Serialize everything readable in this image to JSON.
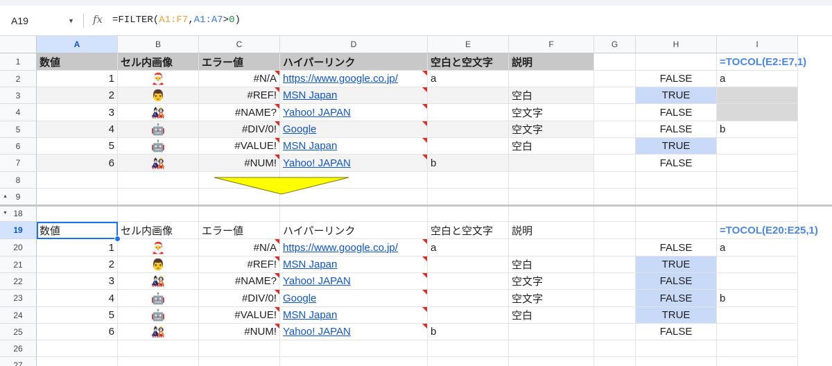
{
  "formula_bar": {
    "cell_ref": "A19",
    "fx": "fx",
    "formula_parts": [
      "=FILTER(",
      "A1:F7",
      ",",
      "A1:A7",
      ">",
      "0",
      ")"
    ]
  },
  "columns": [
    "A",
    "B",
    "C",
    "D",
    "E",
    "F",
    "G",
    "H",
    "I"
  ],
  "rows": [
    "1",
    "2",
    "3",
    "4",
    "5",
    "6",
    "7",
    "8",
    "9",
    "18",
    "19",
    "20",
    "21",
    "22",
    "23",
    "24",
    "25",
    "26",
    "27"
  ],
  "top_table": {
    "headers": [
      "数値",
      "セル内画像",
      "エラー値",
      "ハイパーリンク",
      "空白と空文字",
      "説明"
    ],
    "rows": [
      {
        "num": "1",
        "img": "🎅",
        "err": "#N/A",
        "link": "https://www.google.co.jp/",
        "blank": "a",
        "desc": "",
        "h": "FALSE",
        "i": "a"
      },
      {
        "num": "2",
        "img": "👨",
        "err": "#REF!",
        "link": "MSN Japan",
        "blank": "",
        "desc": "空白",
        "h": "TRUE",
        "i": ""
      },
      {
        "num": "3",
        "img": "🎎",
        "err": "#NAME?",
        "link": "Yahoo! JAPAN",
        "blank": "",
        "desc": "空文字",
        "h": "FALSE",
        "i": ""
      },
      {
        "num": "4",
        "img": "🤖",
        "err": "#DIV/0!",
        "link": "Google",
        "blank": "",
        "desc": "空文字",
        "h": "FALSE",
        "i": "b"
      },
      {
        "num": "5",
        "img": "🤖",
        "err": "#VALUE!",
        "link": "MSN Japan",
        "blank": "",
        "desc": "空白",
        "h": "TRUE",
        "i": ""
      },
      {
        "num": "6",
        "img": "🎎",
        "err": "#NUM!",
        "link": "Yahoo! JAPAN",
        "blank": "b",
        "desc": "",
        "h": "FALSE",
        "i": ""
      }
    ],
    "tocol": "=TOCOL(E2:E7,1)"
  },
  "bottom_table": {
    "headers": [
      "数値",
      "セル内画像",
      "エラー値",
      "ハイパーリンク",
      "空白と空文字",
      "説明"
    ],
    "rows": [
      {
        "num": "1",
        "img": "🎅",
        "err": "#N/A",
        "link": "https://www.google.co.jp/",
        "blank": "a",
        "desc": "",
        "h": "FALSE",
        "i": "a"
      },
      {
        "num": "2",
        "img": "👨",
        "err": "#REF!",
        "link": "MSN Japan",
        "blank": "",
        "desc": "空白",
        "h": "TRUE",
        "i": ""
      },
      {
        "num": "3",
        "img": "🎎",
        "err": "#NAME?",
        "link": "Yahoo! JAPAN",
        "blank": "",
        "desc": "空文字",
        "h": "FALSE",
        "i": ""
      },
      {
        "num": "4",
        "img": "🤖",
        "err": "#DIV/0!",
        "link": "Google",
        "blank": "",
        "desc": "空文字",
        "h": "FALSE",
        "i": "b"
      },
      {
        "num": "5",
        "img": "🤖",
        "err": "#VALUE!",
        "link": "MSN Japan",
        "blank": "",
        "desc": "空白",
        "h": "TRUE",
        "i": ""
      },
      {
        "num": "6",
        "img": "🎎",
        "err": "#NUM!",
        "link": "Yahoo! JAPAN",
        "blank": "b",
        "desc": "",
        "h": "FALSE",
        "i": ""
      }
    ],
    "tocol": "=TOCOL(E20:E25,1)"
  },
  "colors": {
    "header_fill": "#c8c8c8",
    "band_fill": "#f3f3f3",
    "true_fill": "#c9daf8",
    "arrow_fill": "#ffff00",
    "link": "#1155cc",
    "formula_range1": "#e8a33d",
    "formula_range2": "#3c78d8"
  },
  "icons": {
    "namebox_dropdown": "chevron-down-icon",
    "formula": "fx-icon",
    "row_group_toggle": "triangle-toggle-icon",
    "arrow": "down-arrow-shape"
  }
}
